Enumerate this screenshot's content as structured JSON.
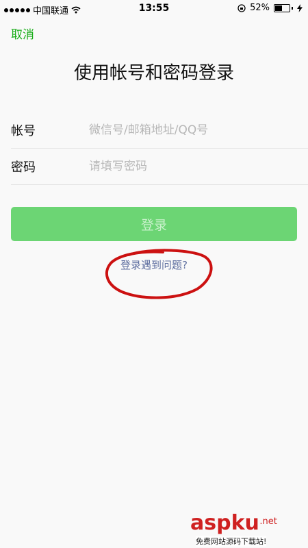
{
  "status_bar": {
    "carrier": "中国联通",
    "time": "13:55",
    "battery_percent": "52%",
    "battery_level": 0.52,
    "icons": [
      "signal-dots-icon",
      "wifi-icon",
      "rotation-lock-icon",
      "battery-icon",
      "charging-icon"
    ]
  },
  "nav": {
    "cancel_label": "取消"
  },
  "page": {
    "title": "使用帐号和密码登录"
  },
  "form": {
    "account_label": "帐号",
    "account_placeholder": "微信号/邮箱地址/QQ号",
    "account_value": "",
    "password_label": "密码",
    "password_placeholder": "请填写密码",
    "password_value": ""
  },
  "actions": {
    "login_label": "登录",
    "problem_label": "登录遇到问题?"
  },
  "colors": {
    "accent_green": "#1aad19",
    "button_green": "#6cd574",
    "link_blue": "#5f6fa0",
    "annotation_red": "#cc1111"
  },
  "watermark": {
    "main": "aspku",
    "net": ".net",
    "sub": "免费网站源码下载站!"
  }
}
